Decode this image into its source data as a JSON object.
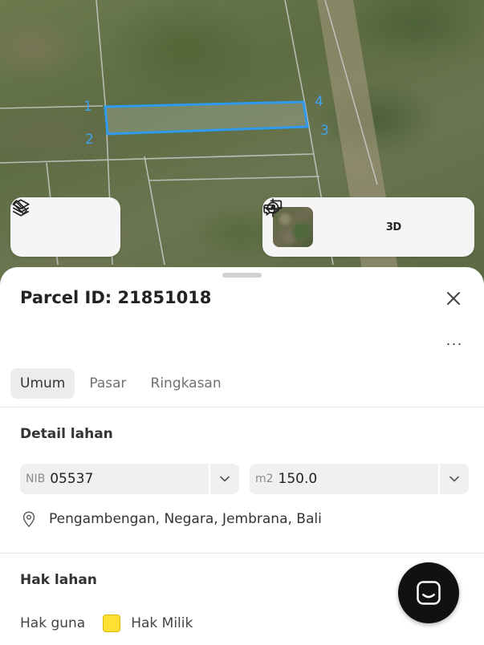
{
  "map": {
    "corner_labels": [
      "1",
      "2",
      "3",
      "4"
    ],
    "parcel_outline_color": "#2e9bf0"
  },
  "map_toolbar_left": {
    "buttons": [
      {
        "icon": "layers-icon"
      },
      {
        "icon": "ruler-icon"
      }
    ]
  },
  "map_toolbar_right": {
    "buttons": [
      {
        "icon": "satellite-thumbnail"
      },
      {
        "icon": "crosshair-icon"
      },
      {
        "label": "3D"
      },
      {
        "icon": "chat-bubbles-icon"
      }
    ]
  },
  "sheet": {
    "title": "Parcel ID: 21851018",
    "more_label": "···",
    "tabs": [
      {
        "label": "Umum",
        "active": true
      },
      {
        "label": "Pasar",
        "active": false
      },
      {
        "label": "Ringkasan",
        "active": false
      }
    ],
    "detail": {
      "title": "Detail lahan",
      "nib_prefix": "NIB",
      "nib_value": "05537",
      "area_prefix": "m2",
      "area_value": "150.0",
      "location": "Pengambengan, Negara, Jembrana, Bali"
    },
    "rights": {
      "title": "Hak lahan",
      "label": "Hak guna",
      "value": "Hak Milik",
      "swatch_color": "#ffe033"
    }
  }
}
